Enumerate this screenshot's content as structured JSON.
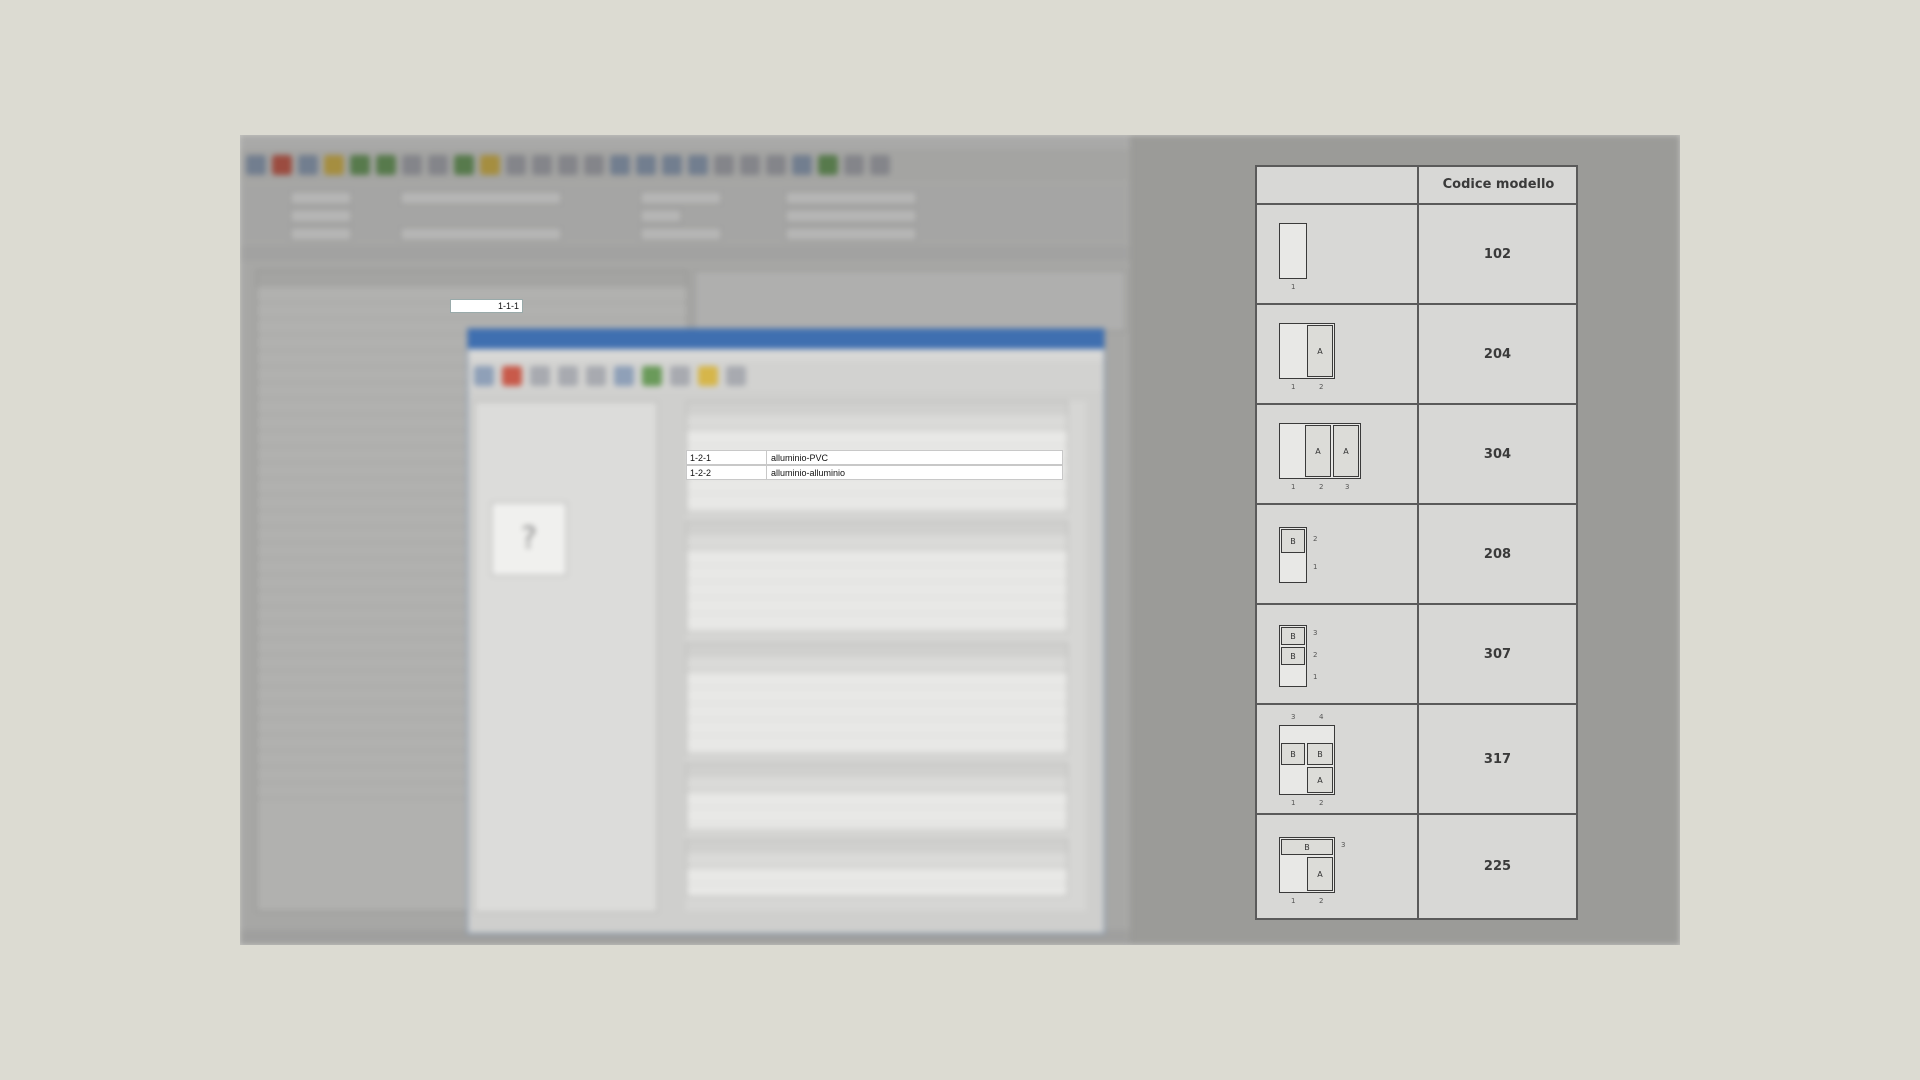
{
  "dialog": {
    "value_cell": "1-1-1",
    "highlighted_rows": [
      {
        "code": "1-2-1",
        "description": "alluminio-PVC"
      },
      {
        "code": "1-2-2",
        "description": "alluminio-alluminio"
      }
    ]
  },
  "model_table": {
    "header": "Codice modello",
    "rows": [
      {
        "code": "102"
      },
      {
        "code": "204"
      },
      {
        "code": "304"
      },
      {
        "code": "208"
      },
      {
        "code": "307"
      },
      {
        "code": "317"
      },
      {
        "code": "225"
      }
    ]
  },
  "colors": {
    "dialog_title": "#3f6fb0",
    "background": "#dcdbd2",
    "table_border": "#5a5a5a"
  }
}
